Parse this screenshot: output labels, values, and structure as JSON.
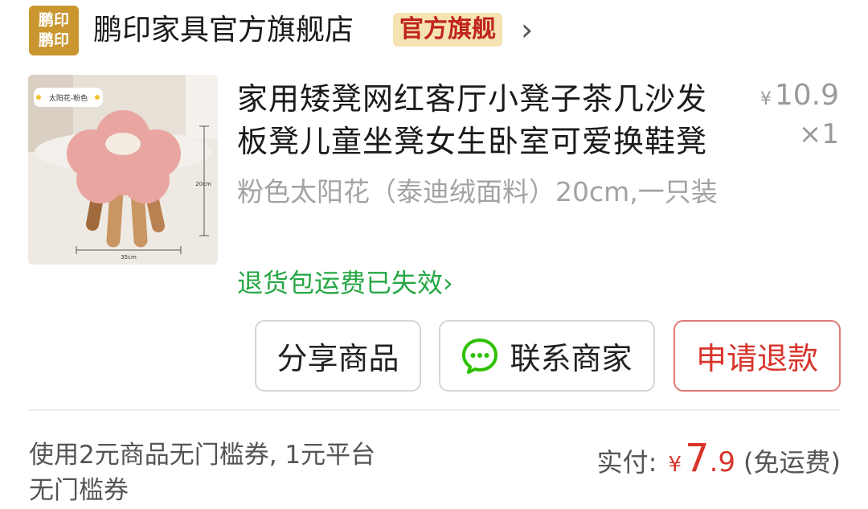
{
  "shop": {
    "logo_line1": "鹏印",
    "logo_line2": "鹏印",
    "name": "鹏印家具官方旗舰店",
    "badge": "官方旗舰",
    "chevron": "›",
    "logo_color": "#c9962f"
  },
  "product": {
    "title": "家用矮凳网红客厅小凳子茶几沙发板凳儿童坐凳女生卧室可爱换鞋凳",
    "price_symbol": "¥",
    "price": "10.9",
    "quantity": "×1",
    "spec": "粉色太阳花（泰迪绒面料）20cm,一只装",
    "return_notice": "退货包运费已失效",
    "return_chevron": "›",
    "thumbnail": {
      "label": "太阳花-粉色",
      "height_label": "20cm",
      "width_label": "35cm"
    }
  },
  "actions": {
    "share": "分享商品",
    "contact": "联系商家",
    "contact_icon": "wechat-chat-icon",
    "refund": "申请退款"
  },
  "summary": {
    "coupon_note": "使用2元商品无门槛券, 1元平台无门槛券",
    "paid_label": "实付:",
    "paid_symbol": "¥",
    "paid_int": "7",
    "paid_dec": ".9",
    "shipping_note": "(免运费)"
  },
  "colors": {
    "accent_red": "#d8342b",
    "green_link": "#27a745",
    "badge_bg": "#f6e3b4",
    "wechat_green": "#2dc100"
  }
}
